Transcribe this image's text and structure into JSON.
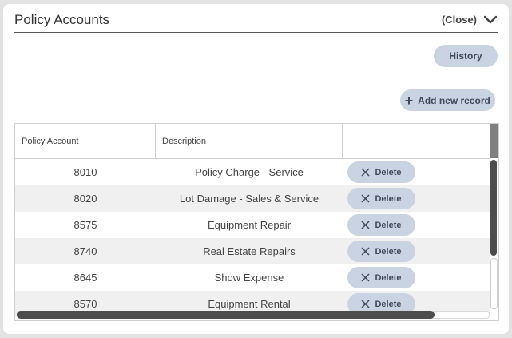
{
  "panel": {
    "title": "Policy Accounts",
    "close_label": "(Close)"
  },
  "toolbar": {
    "history_label": "History",
    "add_label": "Add new record"
  },
  "table": {
    "columns": [
      "Policy Account",
      "Description",
      ""
    ],
    "delete_label": "Delete",
    "rows": [
      {
        "account": "8010",
        "description": "Policy Charge - Service"
      },
      {
        "account": "8020",
        "description": "Lot Damage - Sales & Service"
      },
      {
        "account": "8575",
        "description": "Equipment Repair"
      },
      {
        "account": "8740",
        "description": "Real Estate Repairs"
      },
      {
        "account": "8645",
        "description": "Show Expense"
      },
      {
        "account": "8570",
        "description": "Equipment Rental"
      }
    ]
  },
  "colors": {
    "button_bg": "#c9d3e2",
    "button_text": "#3f4a5a",
    "scroll_thumb": "#4d4d4d"
  },
  "icons": {
    "collapse": "chevron-down-icon",
    "add": "plus-icon",
    "delete": "x-icon"
  }
}
